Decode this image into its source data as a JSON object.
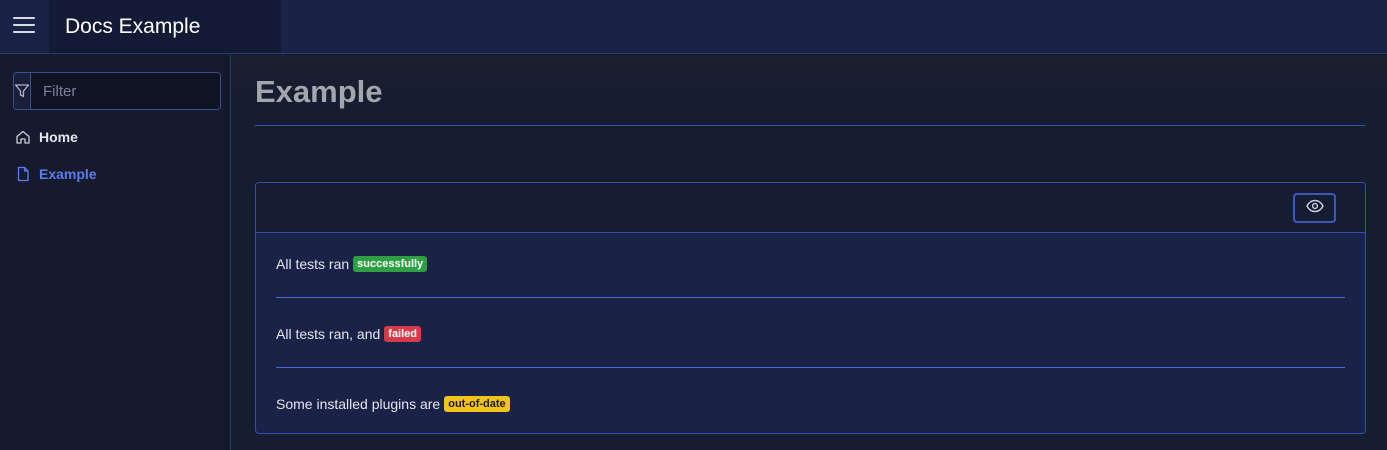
{
  "header": {
    "menu_icon": "hamburger-icon",
    "brand_title": "Docs Example"
  },
  "sidebar": {
    "filter": {
      "icon": "filter-icon",
      "placeholder": "Filter",
      "value": ""
    },
    "items": [
      {
        "label": "Home",
        "icon": "home-icon",
        "active": false
      },
      {
        "label": "Example",
        "icon": "file-icon",
        "active": true
      }
    ]
  },
  "main": {
    "title": "Example",
    "card": {
      "view_icon": "eye-icon",
      "rows": [
        {
          "text": "All tests ran",
          "badge": "successfully",
          "badge_type": "success"
        },
        {
          "text": "All tests ran, and",
          "badge": "failed",
          "badge_type": "danger"
        },
        {
          "text": "Some installed plugins are",
          "badge": "out-of-date",
          "badge_type": "warning"
        }
      ]
    }
  },
  "colors": {
    "accent": "#5b7cf0",
    "success": "#2ea043",
    "danger": "#d73a49",
    "warning": "#f2c31b"
  }
}
